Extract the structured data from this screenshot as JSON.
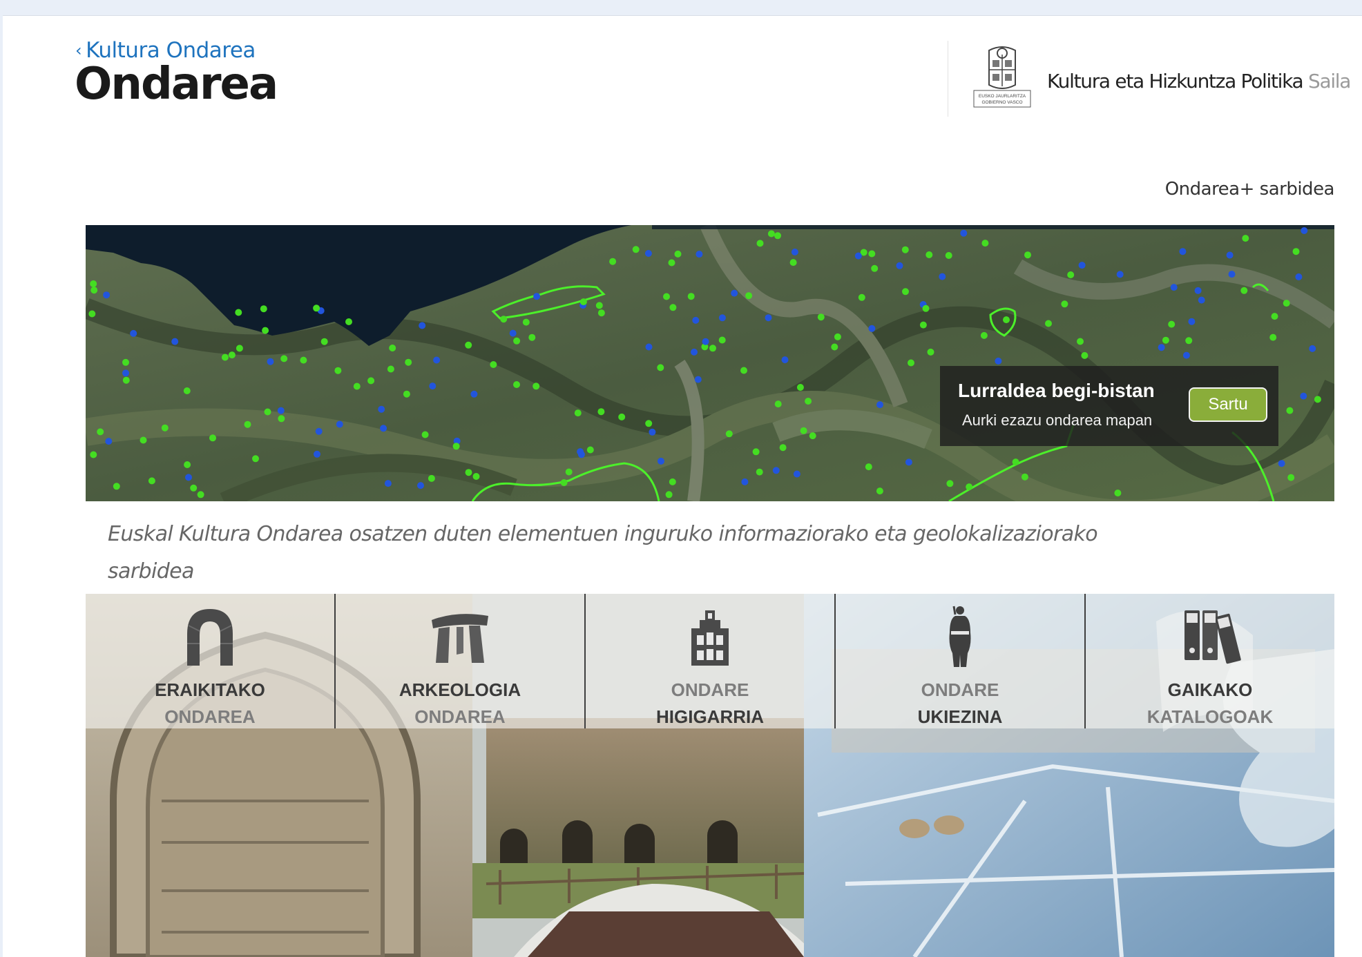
{
  "header": {
    "back_link": "Kultura Ondarea",
    "back_chevron": "‹",
    "title": "Ondarea",
    "logo_icon": "eusko-jaurlaritza-shield",
    "logo_line1": "EUSKO JAURLARITZA",
    "logo_line2": "GOBIERNO VASCO",
    "department": "Kultura eta Hizkuntza Politika",
    "department_suffix": "Saila"
  },
  "access_link": "Ondarea+ sarbidea",
  "map_callout": {
    "title": "Lurraldea begi-bistan",
    "subtitle": "Aurki ezazu ondarea mapan",
    "button": "Sartu"
  },
  "intro_text": "Euskal Kultura Ondarea osatzen duten elementuen inguruko informaziorako eta geolokalizaziorako sarbidea",
  "categories": [
    {
      "line1": "ERAIKITAKO",
      "line2": "ONDAREA",
      "icon": "arch-icon"
    },
    {
      "line1": "ARKEOLOGIA",
      "line2": "ONDAREA",
      "icon": "dolmen-icon"
    },
    {
      "line1": "ONDARE",
      "line2": "HIGIGARRIA",
      "icon": "altarpiece-icon"
    },
    {
      "line1": "ONDARE",
      "line2": "UKIEZINA",
      "icon": "dancer-icon"
    },
    {
      "line1": "GAIKAKO",
      "line2": "KATALOGOAK",
      "icon": "catalog-binders-icon"
    }
  ],
  "colors": {
    "accent_link": "#1e73be",
    "button_green": "#8aad3a",
    "marker_blue": "#2255dd",
    "marker_green": "#44dd22"
  }
}
